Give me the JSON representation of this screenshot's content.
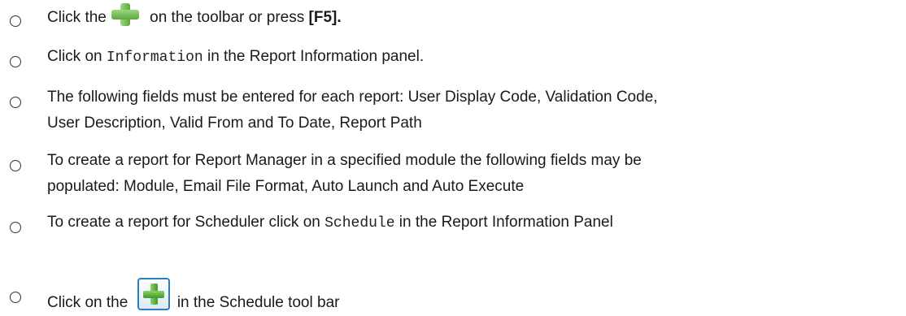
{
  "items": [
    {
      "before": "Click the",
      "after": " on the toolbar or press ",
      "key": "[F5]."
    },
    {
      "before": "Click on ",
      "code": "Information",
      "after": " in the Report Information panel."
    },
    {
      "line1": "The following fields must be entered for each report: User Display Code, Validation Code,",
      "line2": "User Description, Valid From and To Date, Report Path"
    },
    {
      "line1": "To create a report for Report Manager in a specified module the following fields may be",
      "line2": "populated:  Module, Email File Format, Auto Launch and Auto Execute"
    },
    {
      "before": "To create a report for Scheduler click on ",
      "code": "Schedule",
      "after": " in the Report Information Panel"
    },
    {
      "before": "Click on the ",
      "after": " in the Schedule tool bar"
    }
  ],
  "icons": {
    "add_toolbar": "green-plus-icon",
    "add_schedule": "schedule-add-button-icon"
  }
}
